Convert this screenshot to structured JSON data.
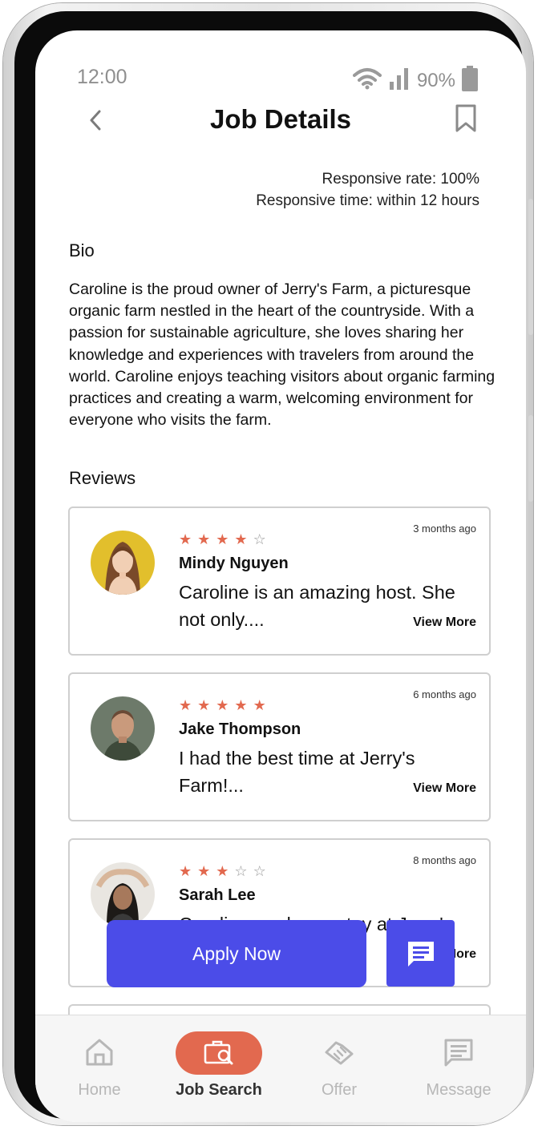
{
  "status_bar": {
    "time": "12:00",
    "battery": "90%"
  },
  "header": {
    "title": "Job Details"
  },
  "host_stats": {
    "responsive_rate": "Responsive rate: 100%",
    "responsive_time": "Responsive time: within 12 hours"
  },
  "bio": {
    "heading": "Bio",
    "text": "Caroline is the proud owner of Jerry's Farm, a picturesque organic farm nestled in the heart of the countryside. With a passion for sustainable agriculture, she loves sharing her knowledge and experiences with travelers from around the world. Caroline enjoys teaching visitors about organic farming practices and creating a warm, welcoming environment for everyone who visits the farm."
  },
  "reviews": {
    "heading": "Reviews",
    "items": [
      {
        "name": "Mindy Nguyen",
        "rating": 4,
        "ago": "3 months ago",
        "text": "Caroline is an amazing host. She not only....",
        "view_more": "View More"
      },
      {
        "name": "Jake Thompson",
        "rating": 5,
        "ago": "6 months ago",
        "text": "I had the best time at Jerry's Farm!...",
        "view_more": "View More"
      },
      {
        "name": "Sarah Lee",
        "rating": 3,
        "ago": "8 months ago",
        "text": "Caroline made my stay at Jerry's",
        "view_more": "View More"
      }
    ]
  },
  "actions": {
    "apply_label": "Apply Now"
  },
  "nav": {
    "items": [
      {
        "label": "Home",
        "icon": "home-icon"
      },
      {
        "label": "Job Search",
        "icon": "briefcase-search-icon",
        "active": true
      },
      {
        "label": "Offer",
        "icon": "handshake-icon"
      },
      {
        "label": "Message",
        "icon": "message-icon"
      }
    ]
  },
  "colors": {
    "accent": "#4b4ce8",
    "nav_active": "#e2694f",
    "star": "#e2694f"
  }
}
